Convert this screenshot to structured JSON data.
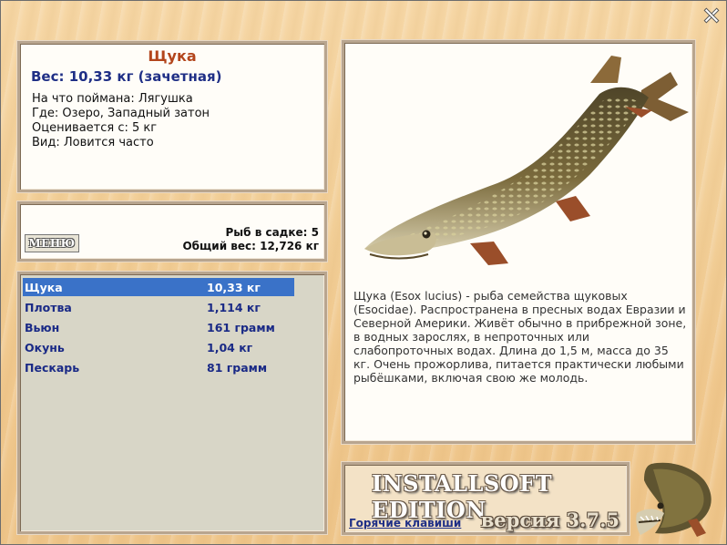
{
  "window": {
    "close_icon": "close-x-icon"
  },
  "catch_info": {
    "fish_name": "Щука",
    "weight_line": "Вес: 10,33 кг (зачетная)",
    "caught_on": "На что поймана: Лягушка",
    "location": "Где: Озеро, Западный затон",
    "valued_from": "Оценивается с: 5 кг",
    "view": "Вид: Ловится часто"
  },
  "cage": {
    "menu_button_label": "МЕНЮ",
    "fish_count": "Рыб в садке: 5",
    "total_weight": "Общий вес: 12,726 кг"
  },
  "catch_list": [
    {
      "name": "Щука",
      "weight": "10,33 кг",
      "selected": true
    },
    {
      "name": "Плотва",
      "weight": "1,114 кг",
      "selected": false
    },
    {
      "name": "Вьюн",
      "weight": "161 грамм",
      "selected": false
    },
    {
      "name": "Окунь",
      "weight": "1,04 кг",
      "selected": false
    },
    {
      "name": "Пескарь",
      "weight": "81 грамм",
      "selected": false
    }
  ],
  "description": {
    "image": "pike-fish-illustration",
    "text": "Щука (Esox lucius) - рыба семейства щуковых (Esocidae). Распространена в пресных водах Евразии и Северной Америки. Живёт обычно в прибрежной зоне, в водных зарослях, в непроточных или слабопроточных водах. Длина до 1,5 м, масса до 35 кг. Очень прожорлива, питается практически любыми рыбёшками, включая свою же молодь."
  },
  "footer": {
    "brand": "INSTALLSOFT EDITION",
    "hotkeys_link": "Горячие клавиши",
    "version": "версия 3.7.5",
    "logo": "pike-logo-icon"
  },
  "colors": {
    "background": "#f2cf98",
    "title": "#b3451c",
    "accent_text": "#1f2f86",
    "selection": "#3a72c8",
    "list_bg": "#d8d6c7"
  }
}
